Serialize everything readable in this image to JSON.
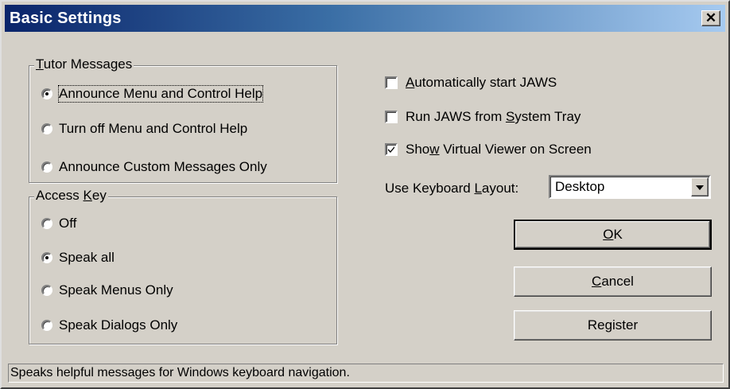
{
  "window": {
    "title": "Basic Settings",
    "close_glyph": "✕"
  },
  "tutor_messages": {
    "legend_mnemonic": "T",
    "legend_rest": "utor Messages",
    "options": [
      {
        "label": "Announce Menu and Control Help",
        "checked": true
      },
      {
        "label": "Turn off Menu and Control Help",
        "checked": false
      },
      {
        "label": "Announce Custom Messages Only",
        "checked": false
      }
    ]
  },
  "access_key": {
    "legend_before": "Access ",
    "legend_mnemonic": "K",
    "legend_after": "ey",
    "options": [
      {
        "label": "Off",
        "checked": false
      },
      {
        "label": "Speak all",
        "checked": true
      },
      {
        "label": "Speak Menus Only",
        "checked": false
      },
      {
        "label": "Speak Dialogs Only",
        "checked": false
      }
    ]
  },
  "checkboxes": [
    {
      "before": "",
      "mnemonic": "A",
      "after": "utomatically start JAWS",
      "checked": false
    },
    {
      "before": "Run JAWS from ",
      "mnemonic": "S",
      "after": "ystem Tray",
      "checked": false
    },
    {
      "before": "Sho",
      "mnemonic": "w",
      "after": " Virtual Viewer on Screen",
      "checked": true
    }
  ],
  "keyboard_layout": {
    "label_before": "Use Keyboard ",
    "label_mnemonic": "L",
    "label_after": "ayout:",
    "value": "Desktop"
  },
  "buttons": {
    "ok_mnemonic": "O",
    "ok_rest": "K",
    "cancel_mnemonic": "C",
    "cancel_rest": "ancel",
    "register": "Register"
  },
  "status_text": "Speaks helpful messages for Windows keyboard navigation."
}
